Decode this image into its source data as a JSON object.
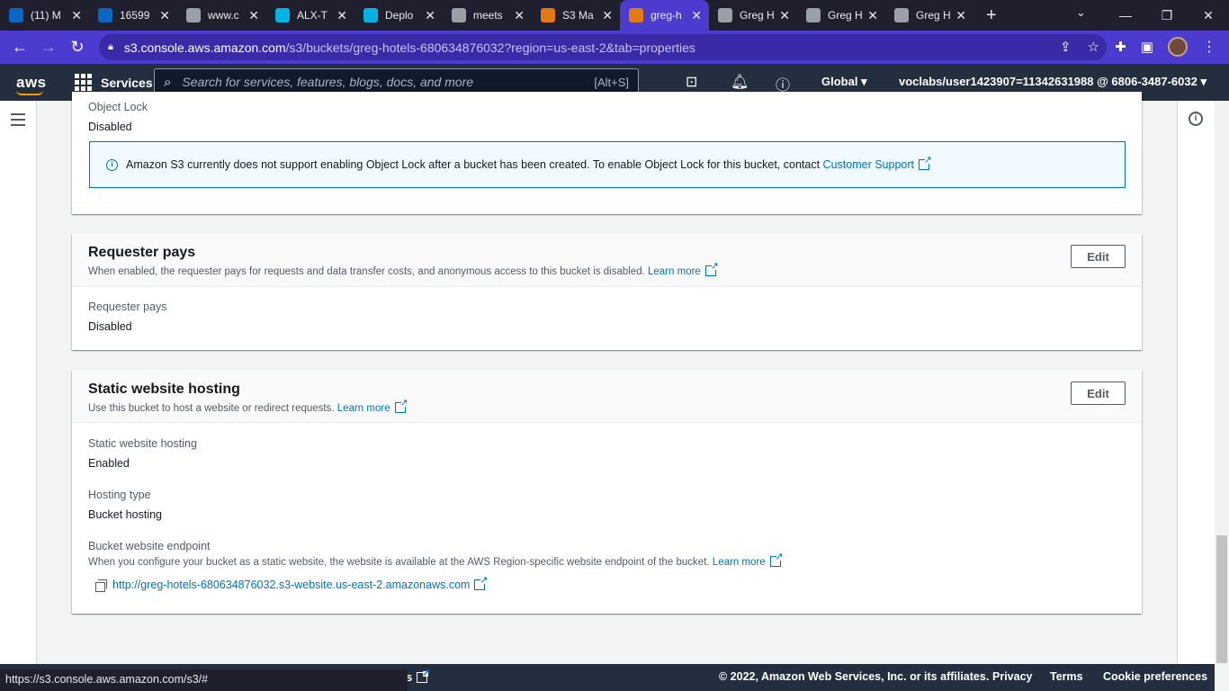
{
  "browser": {
    "tabs": [
      {
        "title": "(11) M",
        "favicon": "linkedin-icon",
        "color": "#0a66c2"
      },
      {
        "title": "16599",
        "favicon": "linkedin-icon",
        "color": "#0a66c2"
      },
      {
        "title": "www.c",
        "favicon": "link-icon",
        "color": "#9aa0a6"
      },
      {
        "title": "ALX-T",
        "favicon": "udacity-icon",
        "color": "#02b3e4"
      },
      {
        "title": "Deplo",
        "favicon": "udacity-icon",
        "color": "#02b3e4"
      },
      {
        "title": "meets",
        "favicon": "globe-icon",
        "color": "#9aa0a6"
      },
      {
        "title": "S3 Ma",
        "favicon": "aws-s3-icon",
        "color": "#e47911"
      },
      {
        "title": "greg-h",
        "favicon": "aws-s3-icon",
        "color": "#e47911"
      },
      {
        "title": "Greg H",
        "favicon": "globe-icon",
        "color": "#9aa0a6"
      },
      {
        "title": "Greg H",
        "favicon": "globe-icon",
        "color": "#9aa0a6"
      },
      {
        "title": "Greg H",
        "favicon": "globe-icon",
        "color": "#9aa0a6"
      }
    ],
    "active_tab_index": 7,
    "url_host": "s3.console.aws.amazon.com",
    "url_path": "/s3/buckets/greg-hotels-680634876032?region=us-east-2&tab=properties",
    "status_url": "https://s3.console.aws.amazon.com/s3/#"
  },
  "aws_nav": {
    "logo": "aws",
    "services_label": "Services",
    "search_placeholder": "Search for services, features, blogs, docs, and more",
    "search_shortcut": "[Alt+S]",
    "region_label": "Global",
    "account_label": "voclabs/user1423907=11342631988 @ 6806-3487-6032"
  },
  "object_lock": {
    "label": "Object Lock",
    "value": "Disabled",
    "alert_text": "Amazon S3 currently does not support enabling Object Lock after a bucket has been created. To enable Object Lock for this bucket, contact",
    "alert_link": "Customer Support"
  },
  "requester_pays": {
    "title": "Requester pays",
    "description": "When enabled, the requester pays for requests and data transfer costs, and anonymous access to this bucket is disabled.",
    "learn_more": "Learn more",
    "edit_label": "Edit",
    "field_label": "Requester pays",
    "field_value": "Disabled"
  },
  "static_hosting": {
    "title": "Static website hosting",
    "description": "Use this bucket to host a website or redirect requests.",
    "learn_more": "Learn more",
    "edit_label": "Edit",
    "hosting_label": "Static website hosting",
    "hosting_value": "Enabled",
    "type_label": "Hosting type",
    "type_value": "Bucket hosting",
    "endpoint_label": "Bucket website endpoint",
    "endpoint_desc": "When you configure your bucket as a static website, the website is available at the AWS Region-specific website endpoint of the bucket.",
    "endpoint_learn_more": "Learn more",
    "endpoint_url": "http://greg-hotels-680634876032.s3-website.us-east-2.amazonaws.com"
  },
  "footer": {
    "fragment": "s",
    "copyright": "© 2022, Amazon Web Services, Inc. or its affiliates.",
    "privacy": "Privacy",
    "terms": "Terms",
    "cookie": "Cookie preferences"
  }
}
